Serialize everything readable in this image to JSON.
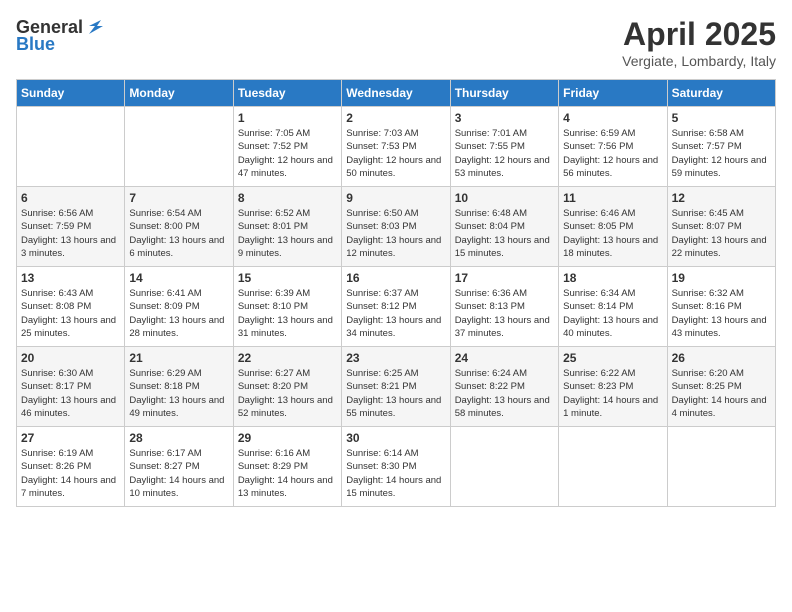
{
  "header": {
    "logo_general": "General",
    "logo_blue": "Blue",
    "title": "April 2025",
    "subtitle": "Vergiate, Lombardy, Italy"
  },
  "days_of_week": [
    "Sunday",
    "Monday",
    "Tuesday",
    "Wednesday",
    "Thursday",
    "Friday",
    "Saturday"
  ],
  "weeks": [
    [
      {
        "day": "",
        "sunrise": "",
        "sunset": "",
        "daylight": ""
      },
      {
        "day": "",
        "sunrise": "",
        "sunset": "",
        "daylight": ""
      },
      {
        "day": "1",
        "sunrise": "Sunrise: 7:05 AM",
        "sunset": "Sunset: 7:52 PM",
        "daylight": "Daylight: 12 hours and 47 minutes."
      },
      {
        "day": "2",
        "sunrise": "Sunrise: 7:03 AM",
        "sunset": "Sunset: 7:53 PM",
        "daylight": "Daylight: 12 hours and 50 minutes."
      },
      {
        "day": "3",
        "sunrise": "Sunrise: 7:01 AM",
        "sunset": "Sunset: 7:55 PM",
        "daylight": "Daylight: 12 hours and 53 minutes."
      },
      {
        "day": "4",
        "sunrise": "Sunrise: 6:59 AM",
        "sunset": "Sunset: 7:56 PM",
        "daylight": "Daylight: 12 hours and 56 minutes."
      },
      {
        "day": "5",
        "sunrise": "Sunrise: 6:58 AM",
        "sunset": "Sunset: 7:57 PM",
        "daylight": "Daylight: 12 hours and 59 minutes."
      }
    ],
    [
      {
        "day": "6",
        "sunrise": "Sunrise: 6:56 AM",
        "sunset": "Sunset: 7:59 PM",
        "daylight": "Daylight: 13 hours and 3 minutes."
      },
      {
        "day": "7",
        "sunrise": "Sunrise: 6:54 AM",
        "sunset": "Sunset: 8:00 PM",
        "daylight": "Daylight: 13 hours and 6 minutes."
      },
      {
        "day": "8",
        "sunrise": "Sunrise: 6:52 AM",
        "sunset": "Sunset: 8:01 PM",
        "daylight": "Daylight: 13 hours and 9 minutes."
      },
      {
        "day": "9",
        "sunrise": "Sunrise: 6:50 AM",
        "sunset": "Sunset: 8:03 PM",
        "daylight": "Daylight: 13 hours and 12 minutes."
      },
      {
        "day": "10",
        "sunrise": "Sunrise: 6:48 AM",
        "sunset": "Sunset: 8:04 PM",
        "daylight": "Daylight: 13 hours and 15 minutes."
      },
      {
        "day": "11",
        "sunrise": "Sunrise: 6:46 AM",
        "sunset": "Sunset: 8:05 PM",
        "daylight": "Daylight: 13 hours and 18 minutes."
      },
      {
        "day": "12",
        "sunrise": "Sunrise: 6:45 AM",
        "sunset": "Sunset: 8:07 PM",
        "daylight": "Daylight: 13 hours and 22 minutes."
      }
    ],
    [
      {
        "day": "13",
        "sunrise": "Sunrise: 6:43 AM",
        "sunset": "Sunset: 8:08 PM",
        "daylight": "Daylight: 13 hours and 25 minutes."
      },
      {
        "day": "14",
        "sunrise": "Sunrise: 6:41 AM",
        "sunset": "Sunset: 8:09 PM",
        "daylight": "Daylight: 13 hours and 28 minutes."
      },
      {
        "day": "15",
        "sunrise": "Sunrise: 6:39 AM",
        "sunset": "Sunset: 8:10 PM",
        "daylight": "Daylight: 13 hours and 31 minutes."
      },
      {
        "day": "16",
        "sunrise": "Sunrise: 6:37 AM",
        "sunset": "Sunset: 8:12 PM",
        "daylight": "Daylight: 13 hours and 34 minutes."
      },
      {
        "day": "17",
        "sunrise": "Sunrise: 6:36 AM",
        "sunset": "Sunset: 8:13 PM",
        "daylight": "Daylight: 13 hours and 37 minutes."
      },
      {
        "day": "18",
        "sunrise": "Sunrise: 6:34 AM",
        "sunset": "Sunset: 8:14 PM",
        "daylight": "Daylight: 13 hours and 40 minutes."
      },
      {
        "day": "19",
        "sunrise": "Sunrise: 6:32 AM",
        "sunset": "Sunset: 8:16 PM",
        "daylight": "Daylight: 13 hours and 43 minutes."
      }
    ],
    [
      {
        "day": "20",
        "sunrise": "Sunrise: 6:30 AM",
        "sunset": "Sunset: 8:17 PM",
        "daylight": "Daylight: 13 hours and 46 minutes."
      },
      {
        "day": "21",
        "sunrise": "Sunrise: 6:29 AM",
        "sunset": "Sunset: 8:18 PM",
        "daylight": "Daylight: 13 hours and 49 minutes."
      },
      {
        "day": "22",
        "sunrise": "Sunrise: 6:27 AM",
        "sunset": "Sunset: 8:20 PM",
        "daylight": "Daylight: 13 hours and 52 minutes."
      },
      {
        "day": "23",
        "sunrise": "Sunrise: 6:25 AM",
        "sunset": "Sunset: 8:21 PM",
        "daylight": "Daylight: 13 hours and 55 minutes."
      },
      {
        "day": "24",
        "sunrise": "Sunrise: 6:24 AM",
        "sunset": "Sunset: 8:22 PM",
        "daylight": "Daylight: 13 hours and 58 minutes."
      },
      {
        "day": "25",
        "sunrise": "Sunrise: 6:22 AM",
        "sunset": "Sunset: 8:23 PM",
        "daylight": "Daylight: 14 hours and 1 minute."
      },
      {
        "day": "26",
        "sunrise": "Sunrise: 6:20 AM",
        "sunset": "Sunset: 8:25 PM",
        "daylight": "Daylight: 14 hours and 4 minutes."
      }
    ],
    [
      {
        "day": "27",
        "sunrise": "Sunrise: 6:19 AM",
        "sunset": "Sunset: 8:26 PM",
        "daylight": "Daylight: 14 hours and 7 minutes."
      },
      {
        "day": "28",
        "sunrise": "Sunrise: 6:17 AM",
        "sunset": "Sunset: 8:27 PM",
        "daylight": "Daylight: 14 hours and 10 minutes."
      },
      {
        "day": "29",
        "sunrise": "Sunrise: 6:16 AM",
        "sunset": "Sunset: 8:29 PM",
        "daylight": "Daylight: 14 hours and 13 minutes."
      },
      {
        "day": "30",
        "sunrise": "Sunrise: 6:14 AM",
        "sunset": "Sunset: 8:30 PM",
        "daylight": "Daylight: 14 hours and 15 minutes."
      },
      {
        "day": "",
        "sunrise": "",
        "sunset": "",
        "daylight": ""
      },
      {
        "day": "",
        "sunrise": "",
        "sunset": "",
        "daylight": ""
      },
      {
        "day": "",
        "sunrise": "",
        "sunset": "",
        "daylight": ""
      }
    ]
  ]
}
